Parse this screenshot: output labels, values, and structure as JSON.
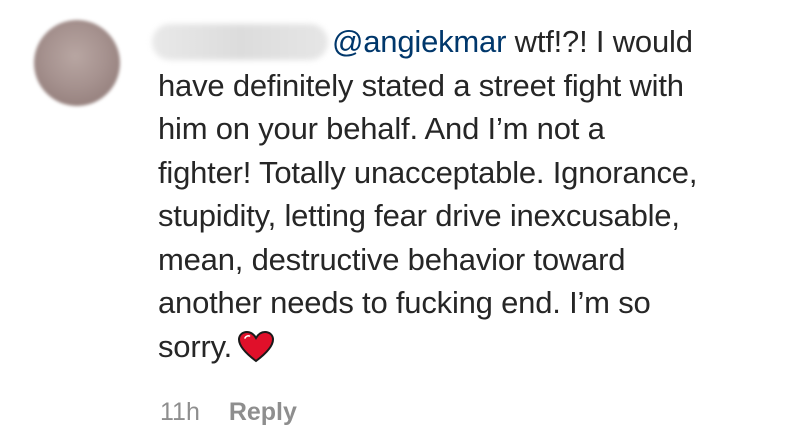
{
  "comment": {
    "mention": "@angiekmar",
    "lines": [
      " wtf!?! I would",
      "have definitely stated a street fight with",
      "him on your behalf. And I’m not a",
      "fighter! Totally unacceptable. Ignorance,",
      "stupidity, letting fear drive inexcusable,",
      "mean, destructive behavior toward",
      "another needs to fucking end. I’m so",
      "sorry."
    ],
    "emoji": "heart-icon",
    "heart_color": "#e0102a"
  },
  "meta": {
    "time": "11h",
    "reply_label": "Reply"
  }
}
